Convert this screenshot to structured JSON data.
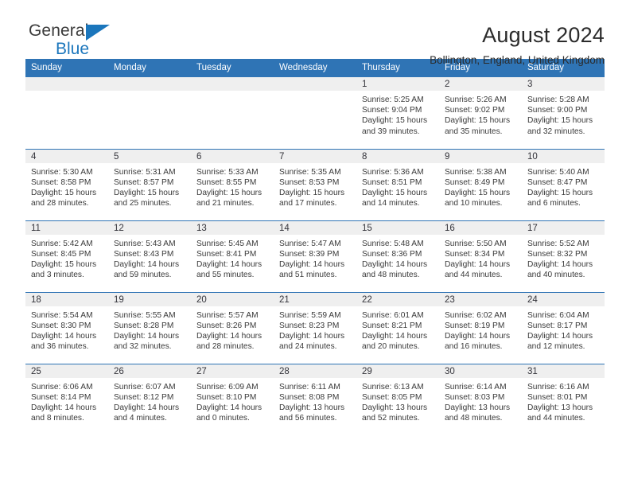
{
  "brand": {
    "name_top": "General",
    "name_bottom": "Blue",
    "triangle_icon": "blue-triangle-logo-mark",
    "accent_color": "#1b76bc"
  },
  "header": {
    "title": "August 2024",
    "subtitle": "Bollington, England, United Kingdom"
  },
  "theme": {
    "header_blue": "#2f74b5",
    "daynum_band": "#efefef",
    "text": "#3a3a3a"
  },
  "weekday_headers": [
    "Sunday",
    "Monday",
    "Tuesday",
    "Wednesday",
    "Thursday",
    "Friday",
    "Saturday"
  ],
  "labels": {
    "sunrise_prefix": "Sunrise:",
    "sunset_prefix": "Sunset:",
    "daylight_prefix": "Daylight:"
  },
  "weeks": [
    [
      {
        "day": "",
        "empty": true
      },
      {
        "day": "",
        "empty": true
      },
      {
        "day": "",
        "empty": true
      },
      {
        "day": "",
        "empty": true
      },
      {
        "day": "1",
        "sunrise": "Sunrise: 5:25 AM",
        "sunset": "Sunset: 9:04 PM",
        "daylight_line1": "Daylight: 15 hours",
        "daylight_line2": "and 39 minutes."
      },
      {
        "day": "2",
        "sunrise": "Sunrise: 5:26 AM",
        "sunset": "Sunset: 9:02 PM",
        "daylight_line1": "Daylight: 15 hours",
        "daylight_line2": "and 35 minutes."
      },
      {
        "day": "3",
        "sunrise": "Sunrise: 5:28 AM",
        "sunset": "Sunset: 9:00 PM",
        "daylight_line1": "Daylight: 15 hours",
        "daylight_line2": "and 32 minutes."
      }
    ],
    [
      {
        "day": "4",
        "sunrise": "Sunrise: 5:30 AM",
        "sunset": "Sunset: 8:58 PM",
        "daylight_line1": "Daylight: 15 hours",
        "daylight_line2": "and 28 minutes."
      },
      {
        "day": "5",
        "sunrise": "Sunrise: 5:31 AM",
        "sunset": "Sunset: 8:57 PM",
        "daylight_line1": "Daylight: 15 hours",
        "daylight_line2": "and 25 minutes."
      },
      {
        "day": "6",
        "sunrise": "Sunrise: 5:33 AM",
        "sunset": "Sunset: 8:55 PM",
        "daylight_line1": "Daylight: 15 hours",
        "daylight_line2": "and 21 minutes."
      },
      {
        "day": "7",
        "sunrise": "Sunrise: 5:35 AM",
        "sunset": "Sunset: 8:53 PM",
        "daylight_line1": "Daylight: 15 hours",
        "daylight_line2": "and 17 minutes."
      },
      {
        "day": "8",
        "sunrise": "Sunrise: 5:36 AM",
        "sunset": "Sunset: 8:51 PM",
        "daylight_line1": "Daylight: 15 hours",
        "daylight_line2": "and 14 minutes."
      },
      {
        "day": "9",
        "sunrise": "Sunrise: 5:38 AM",
        "sunset": "Sunset: 8:49 PM",
        "daylight_line1": "Daylight: 15 hours",
        "daylight_line2": "and 10 minutes."
      },
      {
        "day": "10",
        "sunrise": "Sunrise: 5:40 AM",
        "sunset": "Sunset: 8:47 PM",
        "daylight_line1": "Daylight: 15 hours",
        "daylight_line2": "and 6 minutes."
      }
    ],
    [
      {
        "day": "11",
        "sunrise": "Sunrise: 5:42 AM",
        "sunset": "Sunset: 8:45 PM",
        "daylight_line1": "Daylight: 15 hours",
        "daylight_line2": "and 3 minutes."
      },
      {
        "day": "12",
        "sunrise": "Sunrise: 5:43 AM",
        "sunset": "Sunset: 8:43 PM",
        "daylight_line1": "Daylight: 14 hours",
        "daylight_line2": "and 59 minutes."
      },
      {
        "day": "13",
        "sunrise": "Sunrise: 5:45 AM",
        "sunset": "Sunset: 8:41 PM",
        "daylight_line1": "Daylight: 14 hours",
        "daylight_line2": "and 55 minutes."
      },
      {
        "day": "14",
        "sunrise": "Sunrise: 5:47 AM",
        "sunset": "Sunset: 8:39 PM",
        "daylight_line1": "Daylight: 14 hours",
        "daylight_line2": "and 51 minutes."
      },
      {
        "day": "15",
        "sunrise": "Sunrise: 5:48 AM",
        "sunset": "Sunset: 8:36 PM",
        "daylight_line1": "Daylight: 14 hours",
        "daylight_line2": "and 48 minutes."
      },
      {
        "day": "16",
        "sunrise": "Sunrise: 5:50 AM",
        "sunset": "Sunset: 8:34 PM",
        "daylight_line1": "Daylight: 14 hours",
        "daylight_line2": "and 44 minutes."
      },
      {
        "day": "17",
        "sunrise": "Sunrise: 5:52 AM",
        "sunset": "Sunset: 8:32 PM",
        "daylight_line1": "Daylight: 14 hours",
        "daylight_line2": "and 40 minutes."
      }
    ],
    [
      {
        "day": "18",
        "sunrise": "Sunrise: 5:54 AM",
        "sunset": "Sunset: 8:30 PM",
        "daylight_line1": "Daylight: 14 hours",
        "daylight_line2": "and 36 minutes."
      },
      {
        "day": "19",
        "sunrise": "Sunrise: 5:55 AM",
        "sunset": "Sunset: 8:28 PM",
        "daylight_line1": "Daylight: 14 hours",
        "daylight_line2": "and 32 minutes."
      },
      {
        "day": "20",
        "sunrise": "Sunrise: 5:57 AM",
        "sunset": "Sunset: 8:26 PM",
        "daylight_line1": "Daylight: 14 hours",
        "daylight_line2": "and 28 minutes."
      },
      {
        "day": "21",
        "sunrise": "Sunrise: 5:59 AM",
        "sunset": "Sunset: 8:23 PM",
        "daylight_line1": "Daylight: 14 hours",
        "daylight_line2": "and 24 minutes."
      },
      {
        "day": "22",
        "sunrise": "Sunrise: 6:01 AM",
        "sunset": "Sunset: 8:21 PM",
        "daylight_line1": "Daylight: 14 hours",
        "daylight_line2": "and 20 minutes."
      },
      {
        "day": "23",
        "sunrise": "Sunrise: 6:02 AM",
        "sunset": "Sunset: 8:19 PM",
        "daylight_line1": "Daylight: 14 hours",
        "daylight_line2": "and 16 minutes."
      },
      {
        "day": "24",
        "sunrise": "Sunrise: 6:04 AM",
        "sunset": "Sunset: 8:17 PM",
        "daylight_line1": "Daylight: 14 hours",
        "daylight_line2": "and 12 minutes."
      }
    ],
    [
      {
        "day": "25",
        "sunrise": "Sunrise: 6:06 AM",
        "sunset": "Sunset: 8:14 PM",
        "daylight_line1": "Daylight: 14 hours",
        "daylight_line2": "and 8 minutes."
      },
      {
        "day": "26",
        "sunrise": "Sunrise: 6:07 AM",
        "sunset": "Sunset: 8:12 PM",
        "daylight_line1": "Daylight: 14 hours",
        "daylight_line2": "and 4 minutes."
      },
      {
        "day": "27",
        "sunrise": "Sunrise: 6:09 AM",
        "sunset": "Sunset: 8:10 PM",
        "daylight_line1": "Daylight: 14 hours",
        "daylight_line2": "and 0 minutes."
      },
      {
        "day": "28",
        "sunrise": "Sunrise: 6:11 AM",
        "sunset": "Sunset: 8:08 PM",
        "daylight_line1": "Daylight: 13 hours",
        "daylight_line2": "and 56 minutes."
      },
      {
        "day": "29",
        "sunrise": "Sunrise: 6:13 AM",
        "sunset": "Sunset: 8:05 PM",
        "daylight_line1": "Daylight: 13 hours",
        "daylight_line2": "and 52 minutes."
      },
      {
        "day": "30",
        "sunrise": "Sunrise: 6:14 AM",
        "sunset": "Sunset: 8:03 PM",
        "daylight_line1": "Daylight: 13 hours",
        "daylight_line2": "and 48 minutes."
      },
      {
        "day": "31",
        "sunrise": "Sunrise: 6:16 AM",
        "sunset": "Sunset: 8:01 PM",
        "daylight_line1": "Daylight: 13 hours",
        "daylight_line2": "and 44 minutes."
      }
    ]
  ]
}
